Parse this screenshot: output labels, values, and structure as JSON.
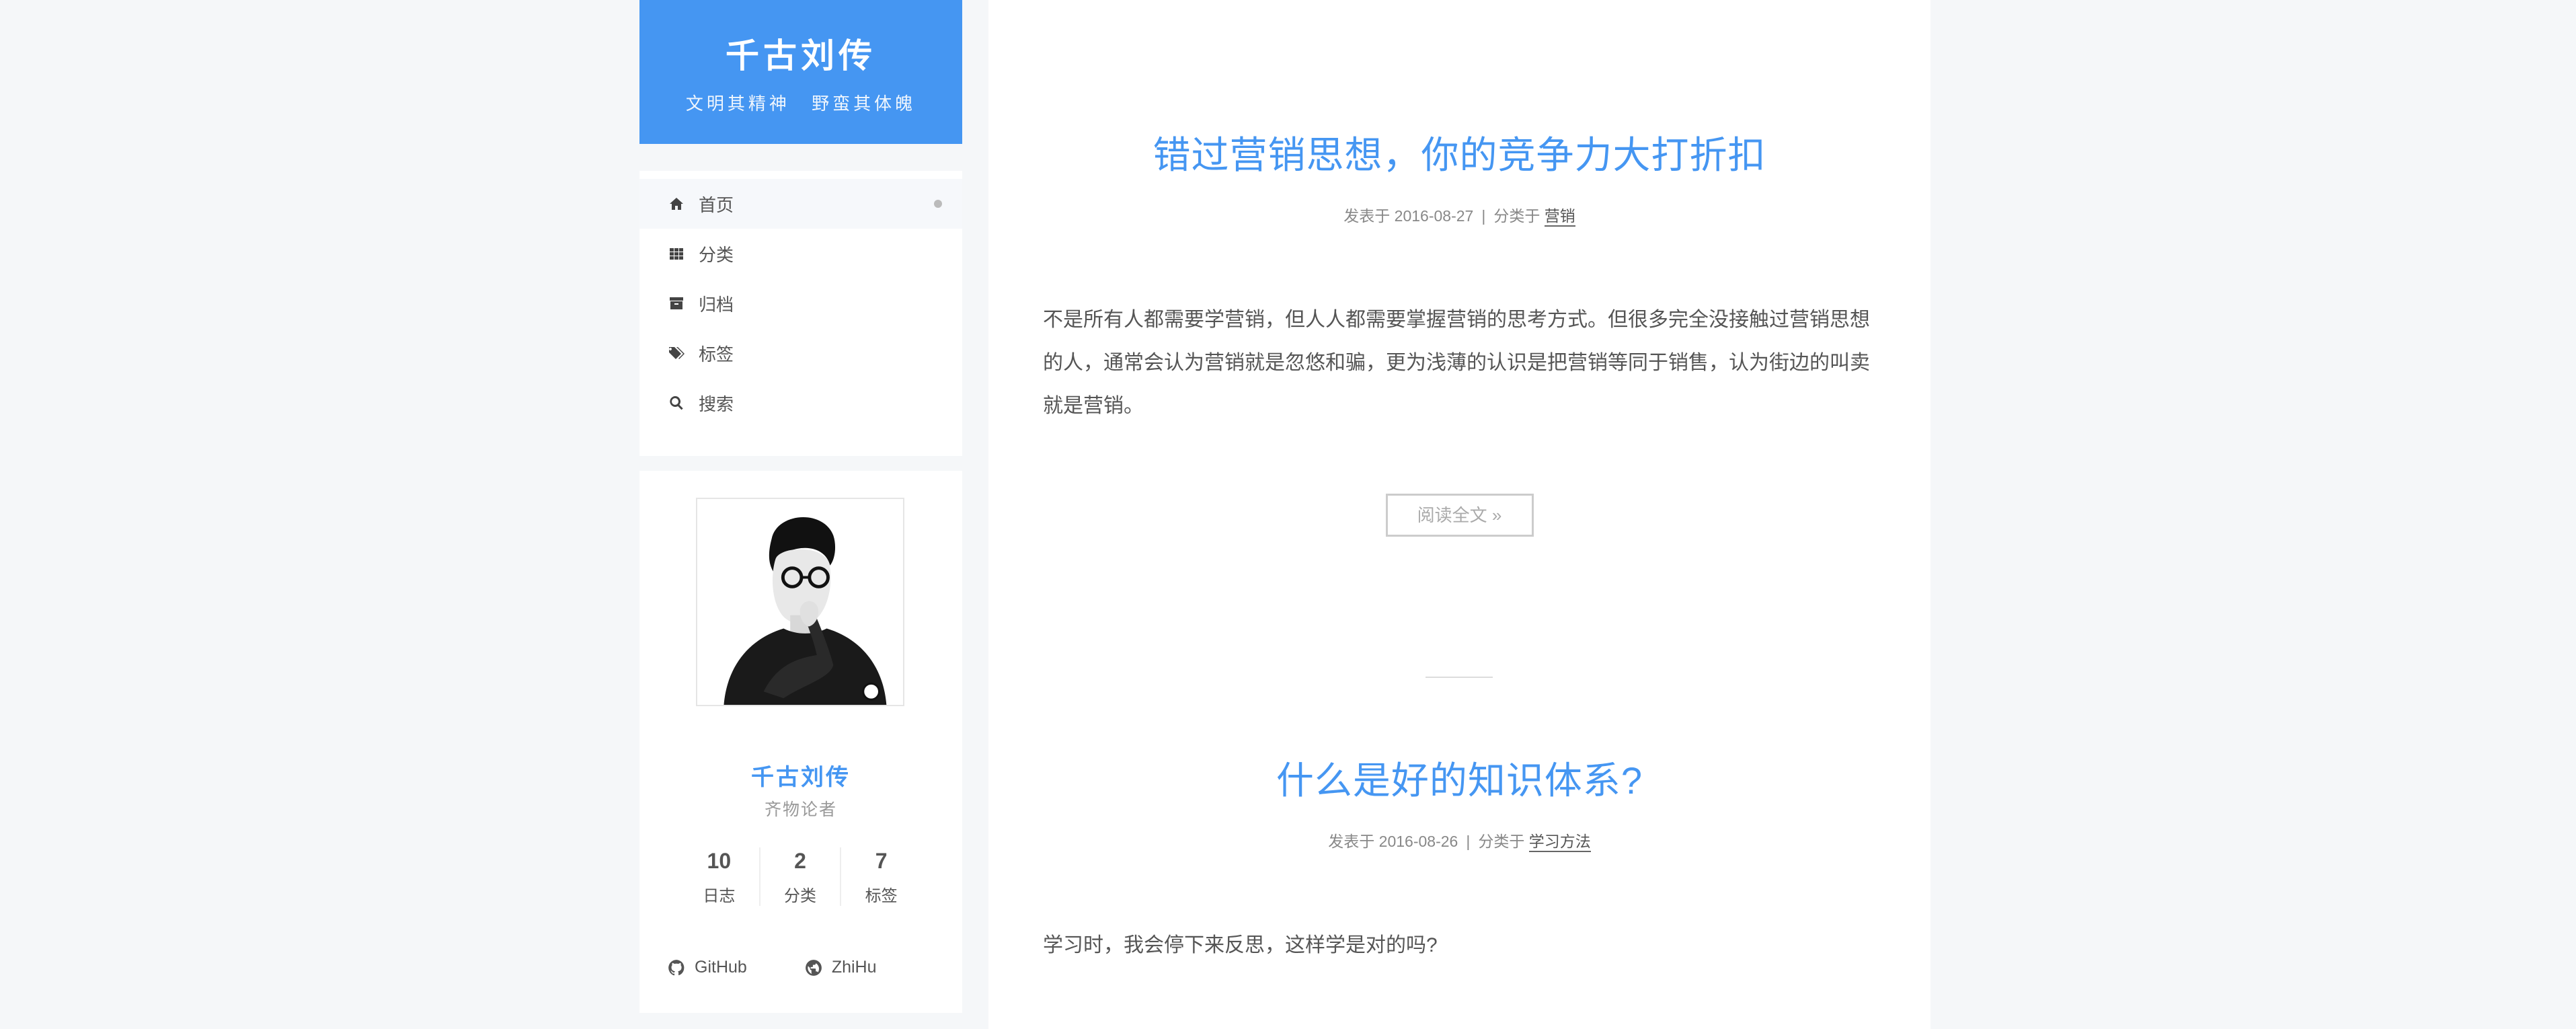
{
  "site": {
    "title": "千古刘传",
    "subtitle": "文明其精神  野蛮其体魄"
  },
  "menu": {
    "items": [
      {
        "label": "首页",
        "icon": "home-icon",
        "active": true
      },
      {
        "label": "分类",
        "icon": "grid-icon"
      },
      {
        "label": "归档",
        "icon": "archive-icon"
      },
      {
        "label": "标签",
        "icon": "tags-icon"
      },
      {
        "label": "搜索",
        "icon": "search-icon"
      }
    ]
  },
  "profile": {
    "name": "千古刘传",
    "description": "齐物论者",
    "stats": [
      {
        "count": "10",
        "label": "日志"
      },
      {
        "count": "2",
        "label": "分类"
      },
      {
        "count": "7",
        "label": "标签"
      }
    ],
    "links": [
      {
        "label": "GitHub",
        "icon": "github-icon"
      },
      {
        "label": "ZhiHu",
        "icon": "globe-icon"
      }
    ]
  },
  "posts": [
    {
      "title": "错过营销思想，你的竞争力大打折扣",
      "meta_published": "发表于 2016-08-27",
      "meta_sep": "|",
      "meta_category_prefix": "分类于",
      "category": "营销",
      "excerpt": "不是所有人都需要学营销，但人人都需要掌握营销的思考方式。但很多完全没接触过营销思想的人，通常会认为营销就是忽悠和骗，更为浅薄的认识是把营销等同于销售，认为街边的叫卖就是营销。",
      "read_more": "阅读全文 »"
    },
    {
      "title": "什么是好的知识体系?",
      "meta_published": "发表于 2016-08-26",
      "meta_sep": "|",
      "meta_category_prefix": "分类于",
      "category": "学习方法",
      "excerpt": "学习时，我会停下来反思，这样学是对的吗?"
    }
  ]
}
